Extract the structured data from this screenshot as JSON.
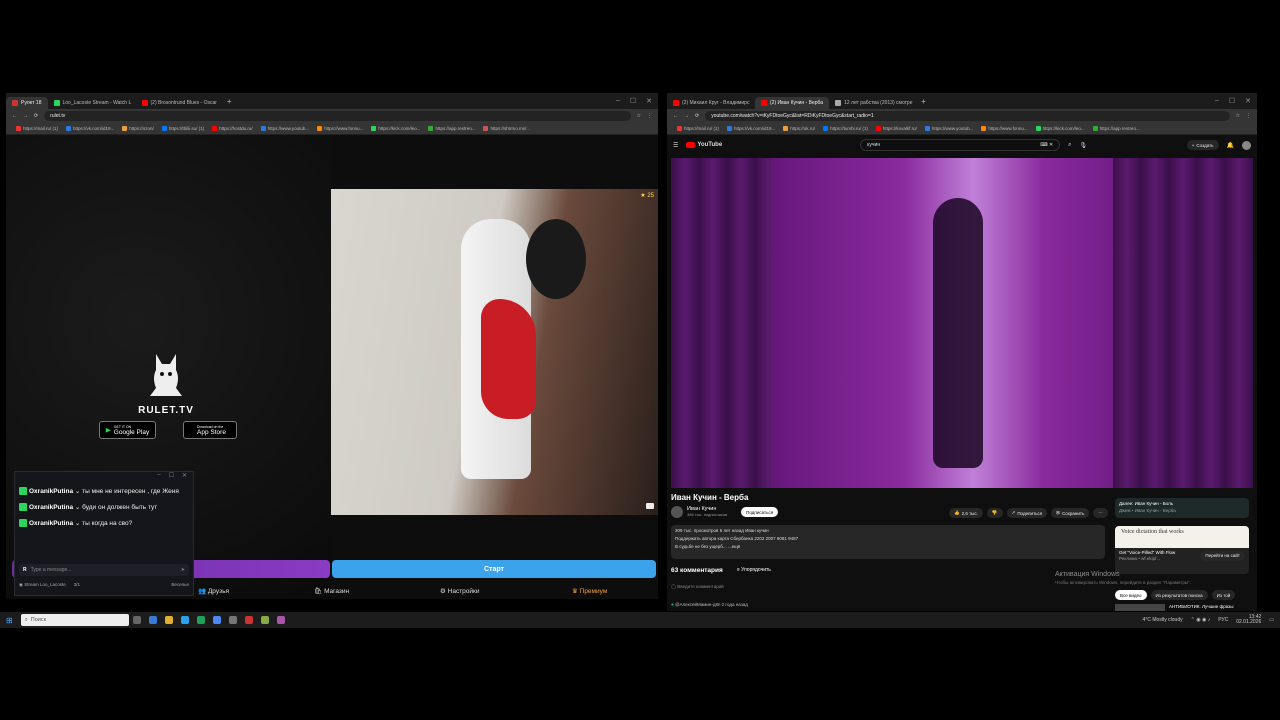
{
  "left_browser": {
    "tabs": [
      {
        "label": "Рулет 18",
        "active": true
      },
      {
        "label": "Loo_Lacoste Stream - Watch L",
        "active": false
      },
      {
        "label": "(2) Brosontrund Blues - Oscar",
        "active": false
      }
    ],
    "url": "rulet.tv",
    "bookmarks": [
      "https://mail.ru/ (1)",
      "https://vk.com/id19...",
      "https://ozon/",
      "https://tbilii.su/ (1)",
      "https://hostdu.ru/",
      "https://www.youtub...",
      "https://www.fonnu...",
      "https://kick.com/leo...",
      "https://app.restreo...",
      "https://shtrmo.ms/..."
    ],
    "rulet": {
      "brand": "RULET.TV",
      "google_play_small": "GET IT ON",
      "google_play": "Google Play",
      "app_store_small": "Download on the",
      "app_store": "App Store",
      "viewer_count": "25",
      "start_button": "Старт",
      "nav": [
        "Друзья",
        "Магазин",
        "Настройки",
        "Премиум"
      ]
    },
    "chat": {
      "messages": [
        {
          "nick": "OxranikPutina",
          "text": "ты мне не интересен , где Женя"
        },
        {
          "nick": "OxranikPutina",
          "text": "буди он должен быть тут"
        },
        {
          "nick": "OxranikPutina",
          "text": "ты когда на сво?"
        }
      ],
      "input_placeholder": "Type a message...",
      "streamer": "Stream Loo_Lacoste",
      "viewers": "3/1",
      "watch_label": "Веселье"
    }
  },
  "right_browser": {
    "tabs": [
      {
        "label": "(2) Михаил Круг - Владимирс",
        "active": false
      },
      {
        "label": "(2) Иван Кучин - Верба",
        "active": true
      },
      {
        "label": "12 лет рабства (2013) смотре",
        "active": false
      }
    ],
    "url": "youtube.com/watch?v=iKyFDtoeGyc&list=RDiKyFDtoeGyc&start_radio=1",
    "bookmarks": [
      "https://mail.ru/ (1)",
      "https://vk.com/id19...",
      "https://ok.ru/",
      "https://tumbi.ru/ (1)",
      "https://kovalkf.ru/",
      "https://www.youtub...",
      "https://www.fonnu...",
      "https://kick.com/leo...",
      "https://app.restreo..."
    ],
    "youtube": {
      "logo": "YouTube",
      "search_value": "кучин",
      "create_button": "Создать",
      "video_title": "Иван Кучин - Верба",
      "channel": "Иван Кучин",
      "subscribers": "386 тыс. подписчиков",
      "subscribe_button": "Подписаться",
      "likes": "2,6 тыс.",
      "share": "Поделиться",
      "save": "Сохранить",
      "desc_line1": "309 тыс. просмотров  6 лет назад  Иван кучин",
      "desc_line2": "Поддержать автора карта Сбербанка 2202 2007 8081 9487",
      "desc_line3": "В судьбе не без ущерб... ...ещё",
      "comments_count": "63 комментария",
      "sort_label": "Упорядочить",
      "comment_placeholder": "Введите комментарий",
      "comment_author": "@АлексейМамин-д8п 2 года назад",
      "next_label": "Далее: Иван Кучин - Боль",
      "next_sub": "Джем • Иван Кучин - Верба",
      "ad_text": "Voice dictation that works",
      "ad_title": "Get \"Voice-Pilled\" With Flow",
      "ad_sponsor": "Реклама • wf.ekipf...",
      "ad_button": "Перейти на сайт",
      "chips": [
        "Все видео",
        "Из результатов поиска",
        "Из той"
      ],
      "side_video": "АНТИБИОТИК. Лучшие фразы"
    },
    "activation_title": "Активация Windows",
    "activation_sub": "Чтобы активировать Windows, перейдите в раздел \"Параметры\"."
  },
  "taskbar": {
    "search_placeholder": "Поиск",
    "weather": "4°C  Mostly cloudy",
    "language": "РУС",
    "time": "13:42",
    "date": "02.01.2026"
  }
}
